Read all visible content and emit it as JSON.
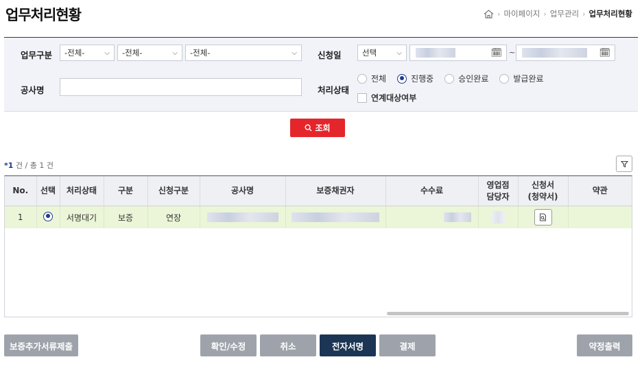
{
  "page": {
    "title": "업무처리현황"
  },
  "breadcrumb": {
    "home_icon": "home-icon",
    "items": [
      "마이페이지",
      "업무관리"
    ],
    "current": "업무처리현황"
  },
  "search": {
    "biz_type_label": "업무구분",
    "biz_type_selects": [
      "-전체-",
      "-전체-",
      "-전체-"
    ],
    "apply_date_label": "신청일",
    "apply_date_select": "선택",
    "date_separator": "~",
    "project_label": "공사명",
    "project_value": "",
    "status_label": "처리상태",
    "status_options": [
      "전체",
      "진행중",
      "승인완료",
      "발급완료"
    ],
    "status_selected": "진행중",
    "linked_checkbox_label": "연계대상여부",
    "search_button": "조회"
  },
  "result": {
    "prefix": "*",
    "count": "1",
    "unit": "건 / 총",
    "total": "1",
    "total_unit": "건"
  },
  "table": {
    "headers": [
      "No.",
      "선택",
      "처리상태",
      "구분",
      "신청구분",
      "공사명",
      "보증채권자",
      "수수료",
      "영업점\n담당자",
      "신청서\n(청약서)",
      "약관"
    ],
    "rows": [
      {
        "no": "1",
        "selected": true,
        "status": "서명대기",
        "type": "보증",
        "apply_type": "연장"
      }
    ]
  },
  "buttons": {
    "add_docs": "보증추가서류제출",
    "confirm_edit": "확인/수정",
    "cancel": "취소",
    "e_sign": "전자서명",
    "payment": "결제",
    "print": "약정출력"
  },
  "colors": {
    "accent": "#1c3554",
    "search_btn": "#e4252b",
    "selected_row": "#ebf5d8",
    "disabled_btn": "#9ea3ab"
  }
}
